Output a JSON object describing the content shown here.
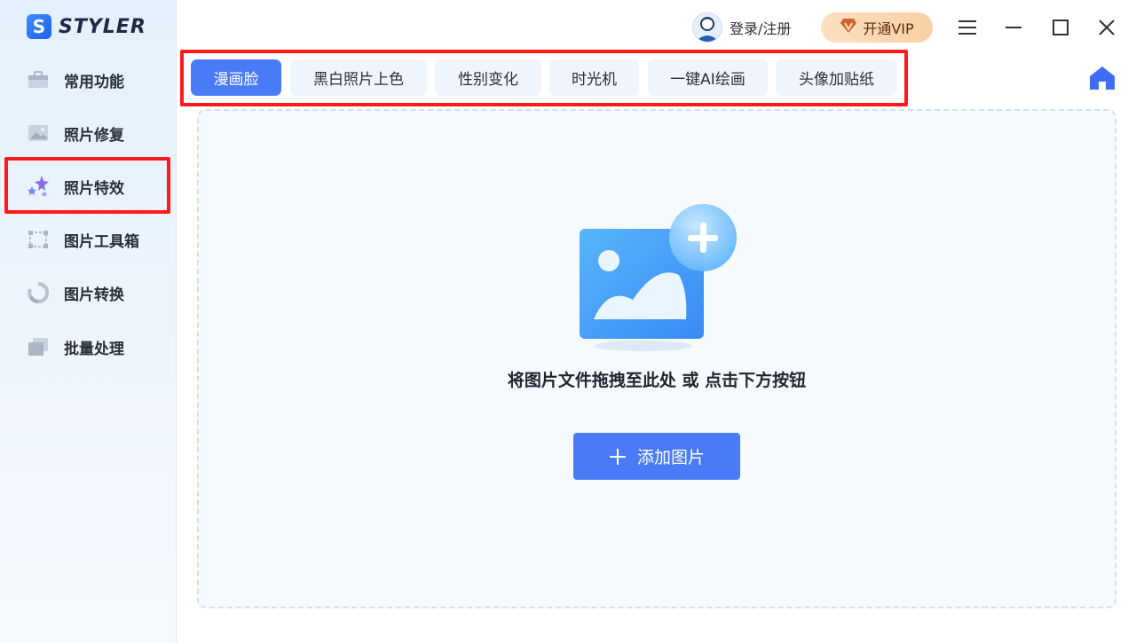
{
  "app": {
    "logo_letter": "S",
    "logo_text": "STYLER"
  },
  "sidebar": {
    "items": [
      {
        "label": "常用功能",
        "icon": "toolbox-icon"
      },
      {
        "label": "照片修复",
        "icon": "photo-repair-icon"
      },
      {
        "label": "照片特效",
        "icon": "sparkle-stars-icon",
        "active": true
      },
      {
        "label": "图片工具箱",
        "icon": "crop-frame-icon"
      },
      {
        "label": "图片转换",
        "icon": "convert-circle-icon"
      },
      {
        "label": "批量处理",
        "icon": "batch-layers-icon"
      }
    ]
  },
  "header": {
    "login_label": "登录/注册",
    "vip_label": "开通VIP"
  },
  "tabs": [
    {
      "label": "漫画脸",
      "active": true
    },
    {
      "label": "黑白照片上色"
    },
    {
      "label": "性别变化"
    },
    {
      "label": "时光机"
    },
    {
      "label": "一键AI绘画"
    },
    {
      "label": "头像加贴纸"
    }
  ],
  "main": {
    "drop_hint": "将图片文件拖拽至此处 或 点击下方按钮",
    "add_button_label": "添加图片"
  },
  "colors": {
    "accent": "#4a7bf7",
    "highlight_border": "#ff1a1a",
    "vip_bg": "#f9cfa4"
  }
}
